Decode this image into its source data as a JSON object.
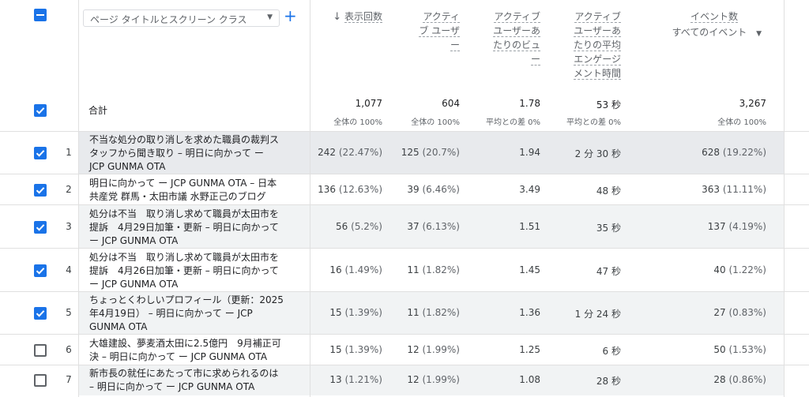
{
  "dimension_selector": {
    "label": "ページ タイトルとスクリーン クラス",
    "add_label": "+"
  },
  "columns": {
    "views": {
      "lines": [
        "表示回数"
      ],
      "sort": "↓"
    },
    "active_users": {
      "lines": [
        "アクティ",
        "ブ ユーザ",
        "ー"
      ]
    },
    "views_per_user": {
      "lines": [
        "アクティブ",
        "ユーザーあ",
        "たりのビュ",
        "ー"
      ]
    },
    "engagement_time": {
      "lines": [
        "アクティブ",
        "ユーザーあ",
        "たりの平均",
        "エンゲージ",
        "メント時間"
      ]
    },
    "event_count": {
      "lines": [
        "イベント数"
      ],
      "filter": "すべてのイベント"
    }
  },
  "totals": {
    "label": "合計",
    "views": "1,077",
    "views_sub": "全体の 100%",
    "active_users": "604",
    "active_users_sub": "全体の 100%",
    "views_per_user": "1.78",
    "views_per_user_sub": "平均との差 0%",
    "engagement_time": "53 秒",
    "engagement_time_sub": "平均との差 0%",
    "event_count": "3,267",
    "event_count_sub": "全体の 100%"
  },
  "rows": [
    {
      "num": "1",
      "checked": true,
      "title_lines": [
        "不当な処分の取り消しを求めた職員の裁判ス",
        "タッフから聞き取り – 明日に向かって ー",
        "JCP GUNMA OTA"
      ],
      "views": "242",
      "views_pct": "(22.47%)",
      "users": "125",
      "users_pct": "(20.7%)",
      "vpu": "1.94",
      "eng": "2 分 30 秒",
      "events": "628",
      "events_pct": "(19.22%)"
    },
    {
      "num": "2",
      "checked": true,
      "title_lines": [
        "明日に向かって ー JCP GUNMA OTA – 日本",
        "共産党 群馬・太田市議 水野正己のブログ"
      ],
      "views": "136",
      "views_pct": "(12.63%)",
      "users": "39",
      "users_pct": "(6.46%)",
      "vpu": "3.49",
      "eng": "48 秒",
      "events": "363",
      "events_pct": "(11.11%)"
    },
    {
      "num": "3",
      "checked": true,
      "title_lines": [
        "処分は不当　取り消し求めて職員が太田市を",
        "提訴　4月29日加筆・更新 – 明日に向かって",
        "ー JCP GUNMA OTA"
      ],
      "views": "56",
      "views_pct": "(5.2%)",
      "users": "37",
      "users_pct": "(6.13%)",
      "vpu": "1.51",
      "eng": "35 秒",
      "events": "137",
      "events_pct": "(4.19%)"
    },
    {
      "num": "4",
      "checked": true,
      "title_lines": [
        "処分は不当　取り消し求めて職員が太田市を",
        "提訴　4月26日加筆・更新 – 明日に向かって",
        "ー JCP GUNMA OTA"
      ],
      "views": "16",
      "views_pct": "(1.49%)",
      "users": "11",
      "users_pct": "(1.82%)",
      "vpu": "1.45",
      "eng": "47 秒",
      "events": "40",
      "events_pct": "(1.22%)"
    },
    {
      "num": "5",
      "checked": true,
      "title_lines": [
        "ちょっとくわしいプロフィール（更新：2025",
        "年4月19日） – 明日に向かって ー JCP",
        "GUNMA OTA"
      ],
      "views": "15",
      "views_pct": "(1.39%)",
      "users": "11",
      "users_pct": "(1.82%)",
      "vpu": "1.36",
      "eng": "1 分 24 秒",
      "events": "27",
      "events_pct": "(0.83%)"
    },
    {
      "num": "6",
      "checked": false,
      "title_lines": [
        "大雄建設、夢麦酒太田に2.5億円　9月補正可",
        "決 – 明日に向かって ー JCP GUNMA OTA"
      ],
      "views": "15",
      "views_pct": "(1.39%)",
      "users": "12",
      "users_pct": "(1.99%)",
      "vpu": "1.25",
      "eng": "6 秒",
      "events": "50",
      "events_pct": "(1.53%)"
    },
    {
      "num": "7",
      "checked": false,
      "title_lines": [
        "新市長の就任にあたって市に求められるのは",
        "– 明日に向かって ー JCP GUNMA OTA"
      ],
      "views": "13",
      "views_pct": "(1.21%)",
      "users": "12",
      "users_pct": "(1.99%)",
      "vpu": "1.08",
      "eng": "28 秒",
      "events": "28",
      "events_pct": "(0.86%)"
    }
  ]
}
